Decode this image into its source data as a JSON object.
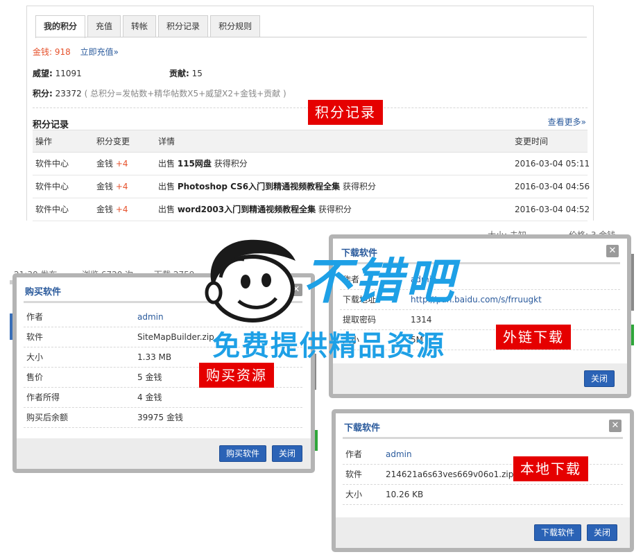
{
  "tabs": [
    "我的积分",
    "充值",
    "转帐",
    "积分记录",
    "积分规则"
  ],
  "summary": {
    "money_label": "金钱:",
    "money_value": "918",
    "recharge_link": "立即充值»",
    "prestige_label": "威望:",
    "prestige_value": "11091",
    "contrib_label": "贡献:",
    "contrib_value": "15",
    "points_label": "积分:",
    "points_value": "23372",
    "points_formula": "( 总积分=发帖数+精华帖数X5+威望X2+金钱+贡献 )"
  },
  "records": {
    "title": "积分记录",
    "see_more": "查看更多»",
    "headers": [
      "操作",
      "积分变更",
      "详情",
      "变更时间"
    ],
    "rows": [
      {
        "op": "软件中心",
        "currency": "金钱",
        "delta": "+4",
        "prefix": "出售",
        "item": "115网盘",
        "suffix": "获得积分",
        "time": "2016-03-04 05:11"
      },
      {
        "op": "软件中心",
        "currency": "金钱",
        "delta": "+4",
        "prefix": "出售",
        "item": "Photoshop CS6入门到精通视频教程全集",
        "suffix": "获得积分",
        "time": "2016-03-04 04:56"
      },
      {
        "op": "软件中心",
        "currency": "金钱",
        "delta": "+4",
        "prefix": "出售",
        "item": "word2003入门到精通视频教程全集",
        "suffix": "获得积分",
        "time": "2016-03-04 04:52"
      }
    ]
  },
  "background": {
    "post_time": "21:30 发布",
    "views": "浏览 6720 次",
    "downloads": "下载 2759",
    "size_unknown": "大小: 未知",
    "price": "价格: 3 金钱"
  },
  "buy_dialog": {
    "title": "购买软件",
    "rows": [
      {
        "k": "作者",
        "v": "admin",
        "link": true
      },
      {
        "k": "软件",
        "v": "SiteMapBuilder.zip"
      },
      {
        "k": "大小",
        "v": "1.33 MB"
      },
      {
        "k": "售价",
        "v": "5 金钱"
      },
      {
        "k": "作者所得",
        "v": "4 金钱"
      },
      {
        "k": "购买后余额",
        "v": "39975 金钱"
      }
    ],
    "buy_button": "购买软件",
    "close_button": "关闭"
  },
  "ext_dialog": {
    "title": "下载软件",
    "rows": [
      {
        "k": "作者",
        "v": "admin",
        "link": true
      },
      {
        "k": "下载地址",
        "v": "http://pan.baidu.com/s/frruugkt",
        "link": true
      },
      {
        "k": "提取密码",
        "v": "1314"
      },
      {
        "k": "大小",
        "v": "5M"
      }
    ],
    "close_button": "关闭"
  },
  "local_dialog": {
    "title": "下载软件",
    "rows": [
      {
        "k": "作者",
        "v": "admin",
        "link": true
      },
      {
        "k": "软件",
        "v": "214621a6s63ves669v06o1.zip"
      },
      {
        "k": "大小",
        "v": "10.26 KB"
      }
    ],
    "download_button": "下载软件",
    "close_button": "关闭"
  },
  "overlays": {
    "badge_records": "积分记录",
    "badge_buy": "购买资源",
    "badge_ext": "外链下载",
    "badge_local": "本地下载",
    "logo_text": "不错吧",
    "logo_sub": "免费提供精品资源"
  },
  "colors": {
    "accent": "#2b63b6",
    "money": "#e6522c",
    "badge": "#e50000",
    "logo": "#1ea0e6"
  }
}
